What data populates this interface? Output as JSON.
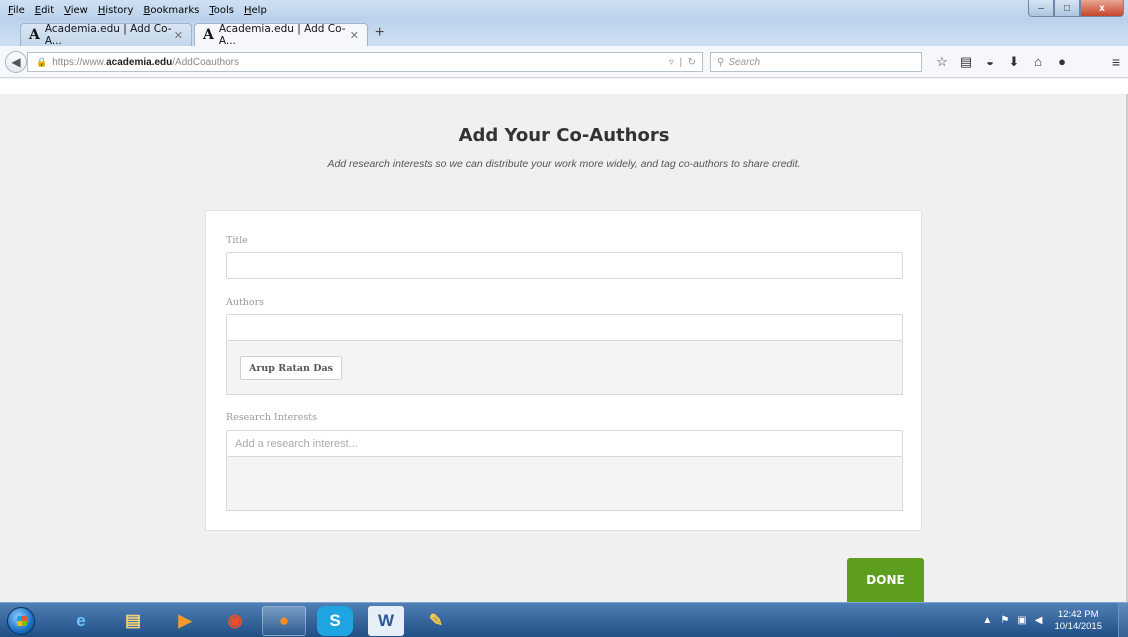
{
  "browser": {
    "menu": [
      "File",
      "Edit",
      "View",
      "History",
      "Bookmarks",
      "Tools",
      "Help"
    ],
    "tabs": [
      {
        "label": "Academia.edu | Add Co-A...",
        "favicon": "A"
      },
      {
        "label": "Academia.edu | Add Co-A...",
        "favicon": "A"
      }
    ],
    "new_tab": "+",
    "url_prefix": "https://www.",
    "url_host": "academia.edu",
    "url_path": "/AddCoauthors",
    "search_placeholder": "Search",
    "window_controls": {
      "minimize": "–",
      "maximize": "□",
      "close": "x"
    }
  },
  "page": {
    "title": "Add Your Co-Authors",
    "subtitle": "Add research interests so we can distribute your work more widely, and tag co-authors to share credit.",
    "fields": {
      "title_label": "Title",
      "title_value": "",
      "authors_label": "Authors",
      "authors_value": "",
      "author_chips": [
        "Arup Ratan Das"
      ],
      "research_label": "Research Interests",
      "research_placeholder": "Add a research interest..."
    },
    "done_label": "DONE",
    "done_color": "#5e9e1f"
  },
  "taskbar": {
    "time": "12:42 PM",
    "date": "10/14/2015",
    "apps": [
      "internet-explorer-icon",
      "file-explorer-icon",
      "media-player-icon",
      "chrome-icon",
      "firefox-icon",
      "skype-icon",
      "word-icon",
      "paint-icon"
    ]
  }
}
